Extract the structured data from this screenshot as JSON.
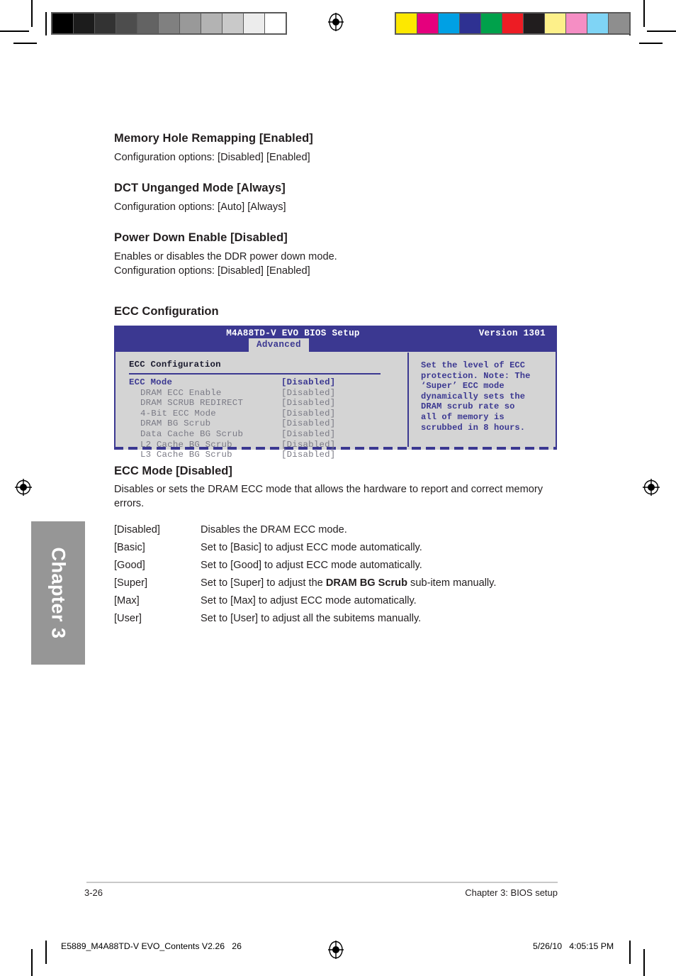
{
  "page": {
    "chapter_tab_label": "Chapter 3",
    "footer_page_number": "3-26",
    "footer_chapter": "Chapter 3: BIOS setup",
    "slug_left": "E5889_M4A88TD-V EVO_Contents V2.26   26",
    "slug_right": "5/26/10   4:05:15 PM"
  },
  "sections": [
    {
      "heading": "Memory Hole Remapping [Enabled]",
      "body": "Configuration options: [Disabled] [Enabled]"
    },
    {
      "heading": "DCT Unganged Mode [Always]",
      "body": "Configuration options: [Auto] [Always]"
    },
    {
      "heading": "Power Down Enable [Disabled]",
      "body": "Enables or disables the DDR power down mode.\nConfiguration options: [Disabled] [Enabled]"
    }
  ],
  "ecc_config_heading": "ECC Configuration",
  "bios": {
    "title": "M4A88TD-V EVO BIOS Setup",
    "version": "Version 1301",
    "tab": "Advanced",
    "panel_title": "ECC Configuration",
    "items": [
      {
        "label": "ECC Mode",
        "value": "[Disabled]",
        "active": true,
        "sub": false
      },
      {
        "label": "DRAM ECC Enable",
        "value": "[Disabled]",
        "active": false,
        "sub": true
      },
      {
        "label": "DRAM SCRUB REDIRECT",
        "value": "[Disabled]",
        "active": false,
        "sub": true
      },
      {
        "label": "4-Bit ECC Mode",
        "value": "[Disabled]",
        "active": false,
        "sub": true
      },
      {
        "label": "DRAM BG Scrub",
        "value": "[Disabled]",
        "active": false,
        "sub": true
      },
      {
        "label": "Data Cache BG Scrub",
        "value": "[Disabled]",
        "active": false,
        "sub": true
      },
      {
        "label": "L2 Cache BG Scrub",
        "value": "[Disabled]",
        "active": false,
        "sub": true
      },
      {
        "label": "L3 Cache BG Scrub",
        "value": "[Disabled]",
        "active": false,
        "sub": true
      }
    ],
    "help_text": "Set the level of ECC\nprotection. Note: The\n‘Super’ ECC mode\ndynamically sets the\nDRAM scrub rate so\nall of memory is\nscrubbed in 8 hours.",
    "colors": {
      "header_bg": "#3b3891",
      "panel_bg": "#d4d4d4",
      "accent": "#3b3891",
      "subitem_text": "#7a7a85"
    }
  },
  "ecc_mode": {
    "heading": "ECC Mode [Disabled]",
    "description": "Disables or sets the DRAM ECC mode that allows the hardware to report and correct memory errors.",
    "options": [
      {
        "key": "[Disabled]",
        "pre": "Disables the DRAM ECC mode.",
        "bold": "",
        "post": ""
      },
      {
        "key": "[Basic]",
        "pre": "Set to [Basic] to adjust ECC mode automatically.",
        "bold": "",
        "post": ""
      },
      {
        "key": "[Good]",
        "pre": "Set to [Good] to adjust ECC mode automatically.",
        "bold": "",
        "post": ""
      },
      {
        "key": "[Super]",
        "pre": "Set to [Super] to adjust the ",
        "bold": "DRAM BG Scrub",
        "post": " sub-item manually."
      },
      {
        "key": "[Max]",
        "pre": "Set to [Max] to adjust ECC mode automatically.",
        "bold": "",
        "post": ""
      },
      {
        "key": "[User]",
        "pre": "Set to [User] to adjust all the subitems manually.",
        "bold": "",
        "post": ""
      }
    ]
  },
  "calibration": {
    "grayscale": [
      "#000000",
      "#1c1c1c",
      "#333333",
      "#4d4d4d",
      "#636363",
      "#808080",
      "#999999",
      "#b3b3b3",
      "#c9c9c9",
      "#ececec",
      "#ffffff"
    ],
    "colors": [
      "#fde800",
      "#e5007d",
      "#00a0e4",
      "#2e3192",
      "#00a14b",
      "#ed1c24",
      "#211d1e",
      "#fdf08a",
      "#f58ec4",
      "#7fd4f5",
      "#8e8e8e"
    ]
  }
}
